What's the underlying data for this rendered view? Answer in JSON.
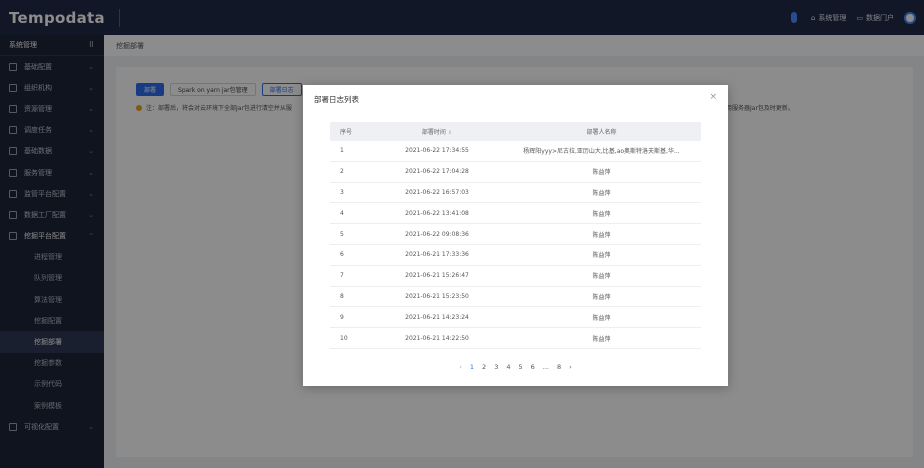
{
  "header": {
    "logo": "Tempodata",
    "system_mgmt": "系统管理",
    "data_portal": "数据门户",
    "system_icon": "home-icon",
    "portal_icon": "monitor-icon"
  },
  "sidebar": {
    "title": "系统管理",
    "items": [
      {
        "label": "基础配置"
      },
      {
        "label": "组织机构"
      },
      {
        "label": "资源管理"
      },
      {
        "label": "调度任务"
      },
      {
        "label": "基础数据"
      },
      {
        "label": "服务管理"
      },
      {
        "label": "监管平台配置"
      },
      {
        "label": "数据工厂配置"
      },
      {
        "label": "挖掘平台配置"
      }
    ],
    "sub_items": [
      {
        "label": "进程管理"
      },
      {
        "label": "队列管理"
      },
      {
        "label": "算法管理"
      },
      {
        "label": "挖掘配置"
      },
      {
        "label": "挖掘部署"
      },
      {
        "label": "挖掘参数"
      },
      {
        "label": "示例代码"
      },
      {
        "label": "案例模板"
      }
    ],
    "last_item": {
      "label": "可视化配置"
    }
  },
  "breadcrumb": "挖掘部署",
  "toolbar": {
    "deploy": "部署",
    "spark": "Spark on yarn jar包管理",
    "log": "部署日志"
  },
  "notice": {
    "left": "注：部署后，将会对云环境下全部Jar包进行清空并从服",
    "right": "用服务器Jar包及时更新。"
  },
  "modal": {
    "title": "部署日志列表",
    "close": "×",
    "columns": {
      "index": "序号",
      "time": "部署时间",
      "user": "部署人名称"
    },
    "rows": [
      {
        "index": "1",
        "time": "2021-06-22 17:34:55",
        "user": "杨辉阳yyy>尼古拉,亚历山大,比基,ao奥斯特洛夫斯基,华..."
      },
      {
        "index": "2",
        "time": "2021-06-22 17:04:28",
        "user": "陈益萍"
      },
      {
        "index": "3",
        "time": "2021-06-22 16:57:03",
        "user": "陈益萍"
      },
      {
        "index": "4",
        "time": "2021-06-22 13:41:08",
        "user": "陈益萍"
      },
      {
        "index": "5",
        "time": "2021-06-22 09:08:36",
        "user": "陈益萍"
      },
      {
        "index": "6",
        "time": "2021-06-21 17:33:36",
        "user": "陈益萍"
      },
      {
        "index": "7",
        "time": "2021-06-21 15:26:47",
        "user": "陈益萍"
      },
      {
        "index": "8",
        "time": "2021-06-21 15:23:50",
        "user": "陈益萍"
      },
      {
        "index": "9",
        "time": "2021-06-21 14:23:24",
        "user": "陈益萍"
      },
      {
        "index": "10",
        "time": "2021-06-21 14:22:50",
        "user": "陈益萍"
      }
    ],
    "pager": {
      "prev": "‹",
      "pages": [
        "1",
        "2",
        "3",
        "4",
        "5",
        "6",
        "...",
        "8"
      ],
      "next": "›"
    }
  }
}
